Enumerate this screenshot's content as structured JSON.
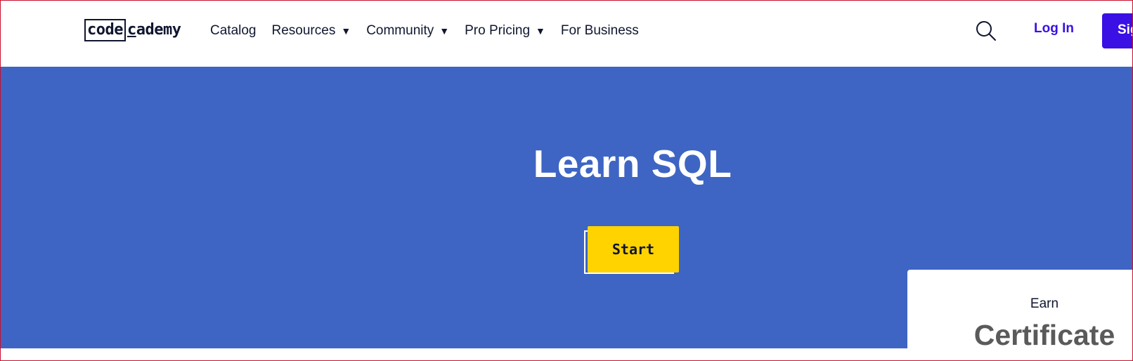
{
  "header": {
    "logo": {
      "box_text": "code",
      "rest_text": "cademy"
    },
    "nav": [
      {
        "label": "Catalog",
        "has_caret": false
      },
      {
        "label": "Resources",
        "has_caret": true
      },
      {
        "label": "Community",
        "has_caret": true
      },
      {
        "label": "Pro Pricing",
        "has_caret": true
      },
      {
        "label": "For Business",
        "has_caret": false
      }
    ],
    "caret_glyph": "▼",
    "search_icon": "search-icon",
    "login_label": "Log In",
    "signup_label": "Sign Up"
  },
  "hero": {
    "title": "Learn SQL",
    "start_label": "Start"
  },
  "certificate": {
    "earn_label": "Earn",
    "title": "Certificate"
  },
  "colors": {
    "hero_bg": "#3e65c3",
    "accent_button": "#ffd300",
    "brand": "#3a10e5",
    "text_dark": "#10162f"
  }
}
